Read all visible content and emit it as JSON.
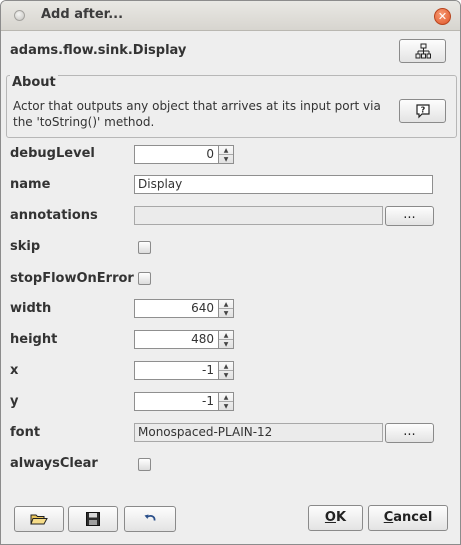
{
  "window": {
    "title": "Add after...",
    "close_glyph": "✕"
  },
  "actor": {
    "classname": "adams.flow.sink.Display",
    "tree_icon": "tree-hierarchy-icon"
  },
  "about": {
    "label": "About",
    "text": "Actor that outputs any object that arrives at its input port via the 'toString()' method.",
    "help_icon": "question-help-icon"
  },
  "properties": {
    "debugLevel": {
      "label": "debugLevel",
      "value": "0"
    },
    "name": {
      "label": "name",
      "value": "Display"
    },
    "annotations": {
      "label": "annotations",
      "value": "",
      "button": "..."
    },
    "skip": {
      "label": "skip",
      "checked": false
    },
    "stopFlowOnError": {
      "label": "stopFlowOnError",
      "checked": false
    },
    "width": {
      "label": "width",
      "value": "640"
    },
    "height": {
      "label": "height",
      "value": "480"
    },
    "x": {
      "label": "x",
      "value": "-1"
    },
    "y": {
      "label": "y",
      "value": "-1"
    },
    "font": {
      "label": "font",
      "value": "Monospaced-PLAIN-12",
      "button": "..."
    },
    "alwaysClear": {
      "label": "alwaysClear",
      "checked": false
    }
  },
  "footer": {
    "open_icon": "open-folder-icon",
    "save_icon": "save-floppy-icon",
    "undo_icon": "undo-arrow-icon",
    "ok_mnemonic": "O",
    "ok_rest": "K",
    "cancel_mnemonic": "C",
    "cancel_rest": "ancel"
  }
}
